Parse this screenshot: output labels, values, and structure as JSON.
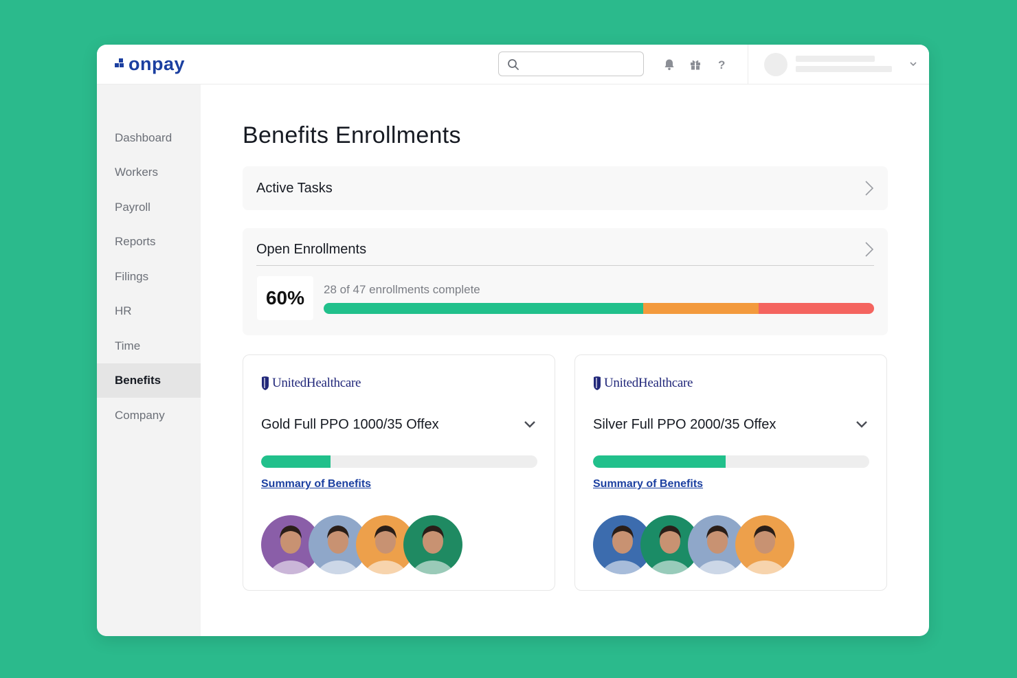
{
  "app": {
    "logo_text": "onpay"
  },
  "search": {
    "placeholder": ""
  },
  "sidebar": {
    "items": [
      {
        "label": "Dashboard",
        "active": false
      },
      {
        "label": "Workers",
        "active": false
      },
      {
        "label": "Payroll",
        "active": false
      },
      {
        "label": "Reports",
        "active": false
      },
      {
        "label": "Filings",
        "active": false
      },
      {
        "label": "HR",
        "active": false
      },
      {
        "label": "Time",
        "active": false
      },
      {
        "label": "Benefits",
        "active": true
      },
      {
        "label": "Company",
        "active": false
      }
    ]
  },
  "main": {
    "title": "Benefits Enrollments",
    "active_tasks": {
      "label": "Active Tasks"
    },
    "open_enrollments": {
      "label": "Open Enrollments",
      "percent_label": "60%",
      "status_text": "28 of 47 enrollments complete",
      "progress_segments": [
        {
          "fraction": 0.58,
          "color": "#21c08b"
        },
        {
          "fraction": 0.21,
          "color": "#f39a3d"
        },
        {
          "fraction": 0.21,
          "color": "#f4645f"
        }
      ]
    },
    "plans": [
      {
        "carrier": "UnitedHealthcare",
        "name": "Gold Full PPO 1000/35 Offex",
        "progress": 0.25,
        "link": "Summary of Benefits",
        "avatar_colors": [
          "#8a5ea8",
          "#8fa7c9",
          "#eda04b",
          "#1f8a62"
        ]
      },
      {
        "carrier": "UnitedHealthcare",
        "name": "Silver Full PPO 2000/35 Offex",
        "progress": 0.48,
        "link": "Summary of Benefits",
        "avatar_colors": [
          "#3c6cae",
          "#1b8c66",
          "#8fa7c9",
          "#eda04b"
        ]
      }
    ]
  },
  "colors": {
    "background": "#2bba8c",
    "brand": "#1b3fa0",
    "accent": "#21c08b"
  },
  "icons": [
    "search-icon",
    "bell-icon",
    "gift-icon",
    "help-icon",
    "chevron-down-icon",
    "chevron-right-icon"
  ]
}
